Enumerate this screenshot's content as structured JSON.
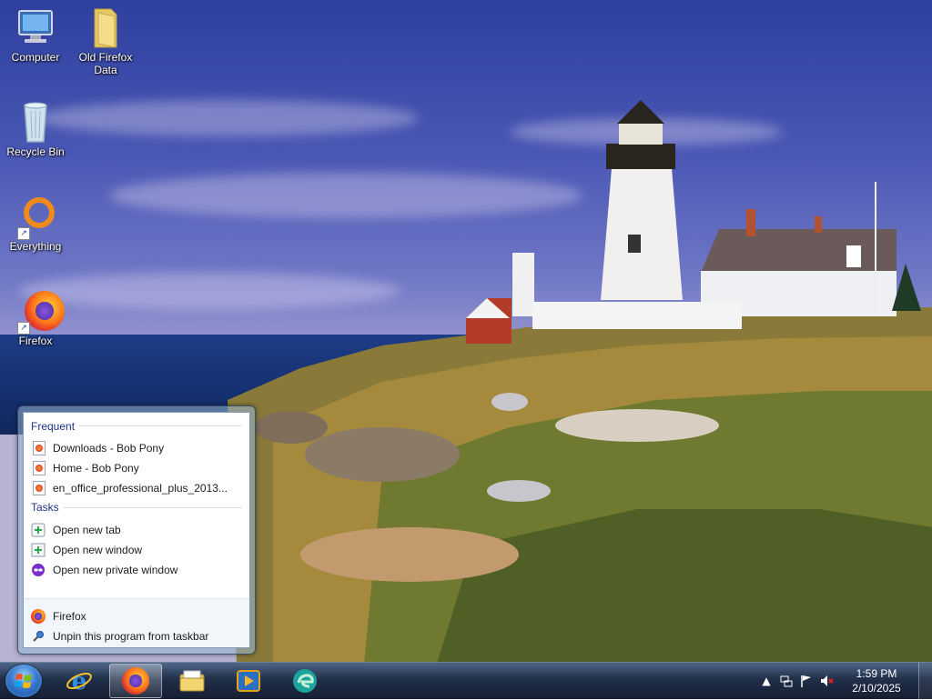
{
  "desktop": {
    "icons": [
      {
        "label": "Computer"
      },
      {
        "label": "Old Firefox\nData"
      },
      {
        "label": "Recycle Bin"
      },
      {
        "label": "Everything"
      },
      {
        "label": "Firefox"
      }
    ]
  },
  "jumplist": {
    "frequent_header": "Frequent",
    "frequent": [
      {
        "label": "Downloads - Bob Pony"
      },
      {
        "label": "Home - Bob Pony"
      },
      {
        "label": "en_office_professional_plus_2013..."
      }
    ],
    "tasks_header": "Tasks",
    "tasks": [
      {
        "label": "Open new tab",
        "icon": "new-tab-icon"
      },
      {
        "label": "Open new window",
        "icon": "new-window-icon"
      },
      {
        "label": "Open new private window",
        "icon": "private-window-icon"
      }
    ],
    "footer": [
      {
        "label": "Firefox",
        "icon": "firefox-icon"
      },
      {
        "label": "Unpin this program from taskbar",
        "icon": "pin-icon"
      }
    ]
  },
  "taskbar": {
    "apps": [
      "Internet Explorer",
      "Firefox",
      "Windows Explorer",
      "Windows Media Player",
      "Edge"
    ],
    "active_app": "Firefox"
  },
  "clock": {
    "time": "1:59 PM",
    "date": "2/10/2025"
  },
  "colors": {
    "jumplist_header": "#1e3287",
    "taskbar": "#1a2a45"
  }
}
